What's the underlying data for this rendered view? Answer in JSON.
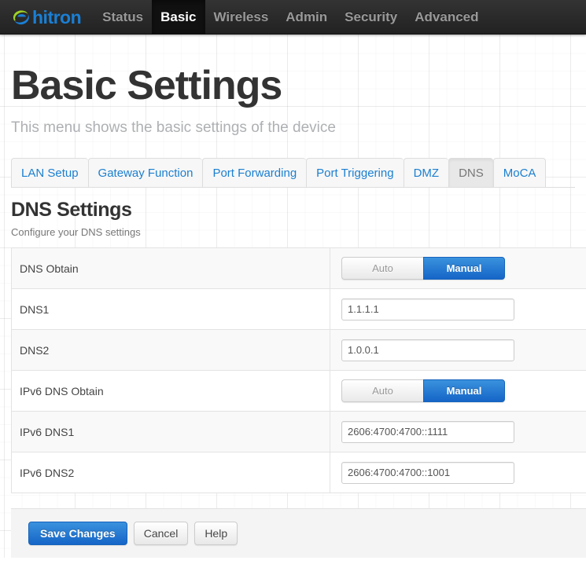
{
  "navbar": {
    "brand": {
      "name": "hitron",
      "logo_icon": "hitron-swoosh-logo"
    },
    "items": [
      {
        "label": "Status",
        "active": false
      },
      {
        "label": "Basic",
        "active": true
      },
      {
        "label": "Wireless",
        "active": false
      },
      {
        "label": "Admin",
        "active": false
      },
      {
        "label": "Security",
        "active": false
      },
      {
        "label": "Advanced",
        "active": false
      }
    ]
  },
  "hero": {
    "title": "Basic Settings",
    "lead": "This menu shows the basic settings of the device"
  },
  "tabs": [
    {
      "label": "LAN Setup",
      "active": false
    },
    {
      "label": "Gateway Function",
      "active": false
    },
    {
      "label": "Port Forwarding",
      "active": false
    },
    {
      "label": "Port Triggering",
      "active": false
    },
    {
      "label": "DMZ",
      "active": false
    },
    {
      "label": "DNS",
      "active": true
    },
    {
      "label": "MoCA",
      "active": false
    }
  ],
  "section": {
    "title": "DNS Settings",
    "subtitle": "Configure your DNS settings"
  },
  "toggle_options": {
    "auto": "Auto",
    "manual": "Manual"
  },
  "rows": [
    {
      "label": "DNS Obtain",
      "type": "toggle",
      "selected": "Manual"
    },
    {
      "label": "DNS1",
      "type": "input",
      "value": "1.1.1.1"
    },
    {
      "label": "DNS2",
      "type": "input",
      "value": "1.0.0.1"
    },
    {
      "label": "IPv6 DNS Obtain",
      "type": "toggle",
      "selected": "Manual"
    },
    {
      "label": "IPv6 DNS1",
      "type": "input",
      "value": "2606:4700:4700::1111"
    },
    {
      "label": "IPv6 DNS2",
      "type": "input",
      "value": "2606:4700:4700::1001"
    }
  ],
  "footer": {
    "save_label": "Save Changes",
    "cancel_label": "Cancel",
    "help_label": "Help"
  },
  "colors": {
    "accent_blue": "#1565c7",
    "link_blue": "#1b7fd0",
    "navbar_dark": "#262626",
    "row_stripe": "#f9f9f9"
  }
}
